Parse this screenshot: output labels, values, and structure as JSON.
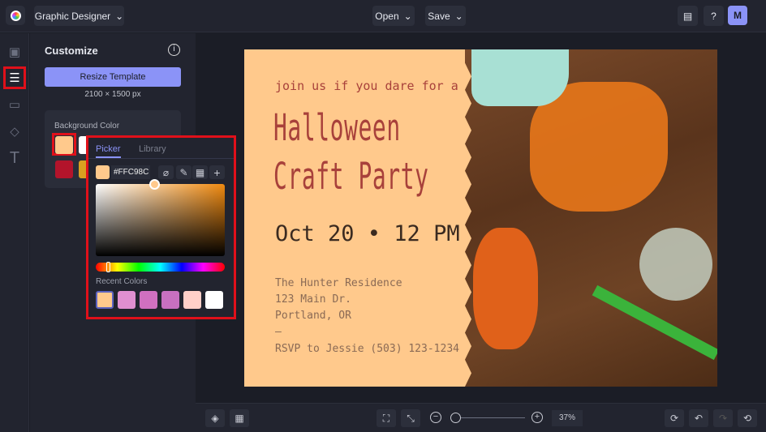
{
  "header": {
    "app_mode": "Graphic Designer",
    "open_label": "Open",
    "save_label": "Save",
    "avatar": "M"
  },
  "panel": {
    "title": "Customize",
    "resize_label": "Resize Template",
    "dimensions": "2100 × 1500 px",
    "bg_label": "Background Color",
    "bg_colors": [
      "#FFC98C",
      "#FFFFFF",
      "#B3142B",
      "#D9A020"
    ]
  },
  "picker": {
    "tab_picker": "Picker",
    "tab_library": "Library",
    "hex": "#FFC98C",
    "recent_label": "Recent Colors",
    "recent": [
      "#FFC98C",
      "#E08FD0",
      "#D070C0",
      "#C870C0",
      "#FFD0C8",
      "#FFFFFF"
    ]
  },
  "card": {
    "intro": "join us if you dare for a",
    "title1": "Halloween",
    "title2": "Craft Party",
    "date": "Oct 20 • 12 PM",
    "addr1": "The Hunter Residence",
    "addr2": "123 Main Dr.",
    "addr3": "Portland, OR",
    "dash": "–",
    "rsvp": "RSVP to Jessie (503) 123-1234"
  },
  "bottom": {
    "zoom": "37%",
    "zoom_level": 0.05
  }
}
